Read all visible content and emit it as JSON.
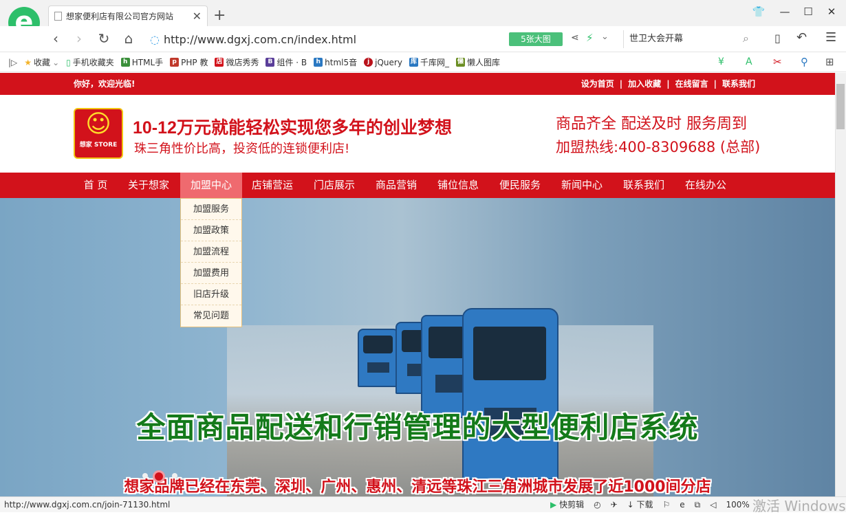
{
  "browser": {
    "tab_title": "想家便利店有限公司官方网站",
    "url": "http://www.dgxj.com.cn/index.html",
    "image_button": "5张大图",
    "search_text": "世卫大会开幕",
    "bookmarks": [
      {
        "label": "收藏",
        "icon": "star-icon"
      },
      {
        "label": "手机收藏夹",
        "icon": "phone-icon"
      },
      {
        "label": "HTML手",
        "icon": "html-icon"
      },
      {
        "label": "PHP 教",
        "icon": "php-icon"
      },
      {
        "label": "微店秀秀",
        "icon": "shop-icon"
      },
      {
        "label": "组件 · B",
        "icon": "b-icon"
      },
      {
        "label": "html5音",
        "icon": "html5-icon"
      },
      {
        "label": "jQuery",
        "icon": "jquery-icon"
      },
      {
        "label": "千库网_",
        "icon": "qianku-icon"
      },
      {
        "label": "懒人图库",
        "icon": "lanren-icon"
      }
    ],
    "status_url": "http://www.dgxj.com.cn/join-71130.html",
    "status_items": [
      "快剪辑",
      "下载"
    ],
    "zoom": "100%",
    "watermark": "激活 Windows"
  },
  "site": {
    "welcome": "你好，欢迎光临!",
    "top_links": [
      "设为首页",
      "加入收藏",
      "在线留言",
      "联系我们"
    ],
    "separator": "|",
    "brand_name": "想家 STORE",
    "slogan_main": "10-12万元就能轻松实现您多年的创业梦想",
    "slogan_sub": "珠三角性价比高，投资低的连锁便利店!",
    "features": "商品齐全  配送及时  服务周到",
    "hotline": "加盟热线:400-8309688 (总部)",
    "nav": [
      {
        "label": "首 页",
        "active": false
      },
      {
        "label": "关于想家",
        "active": false
      },
      {
        "label": "加盟中心",
        "active": true
      },
      {
        "label": "店铺营运",
        "active": false
      },
      {
        "label": "门店展示",
        "active": false
      },
      {
        "label": "商品营销",
        "active": false
      },
      {
        "label": "铺位信息",
        "active": false
      },
      {
        "label": "便民服务",
        "active": false
      },
      {
        "label": "新闻中心",
        "active": false
      },
      {
        "label": "联系我们",
        "active": false
      },
      {
        "label": "在线办公",
        "active": false
      }
    ],
    "dropdown": [
      "加盟服务",
      "加盟政策",
      "加盟流程",
      "加盟费用",
      "旧店升级",
      "常见问题"
    ],
    "banner_headline": "全面商品配送和行销管理的大型便利店系统",
    "banner_subline": "想家品牌已经在东莞、深圳、广州、惠州、清远等珠江三角洲城市发展了近1000间分店",
    "slide_count": 3,
    "slide_active": 2
  },
  "colors": {
    "brand_red": "#d2121b",
    "nav_active": "#ef6a6f",
    "headline_green": "#147a1a"
  }
}
